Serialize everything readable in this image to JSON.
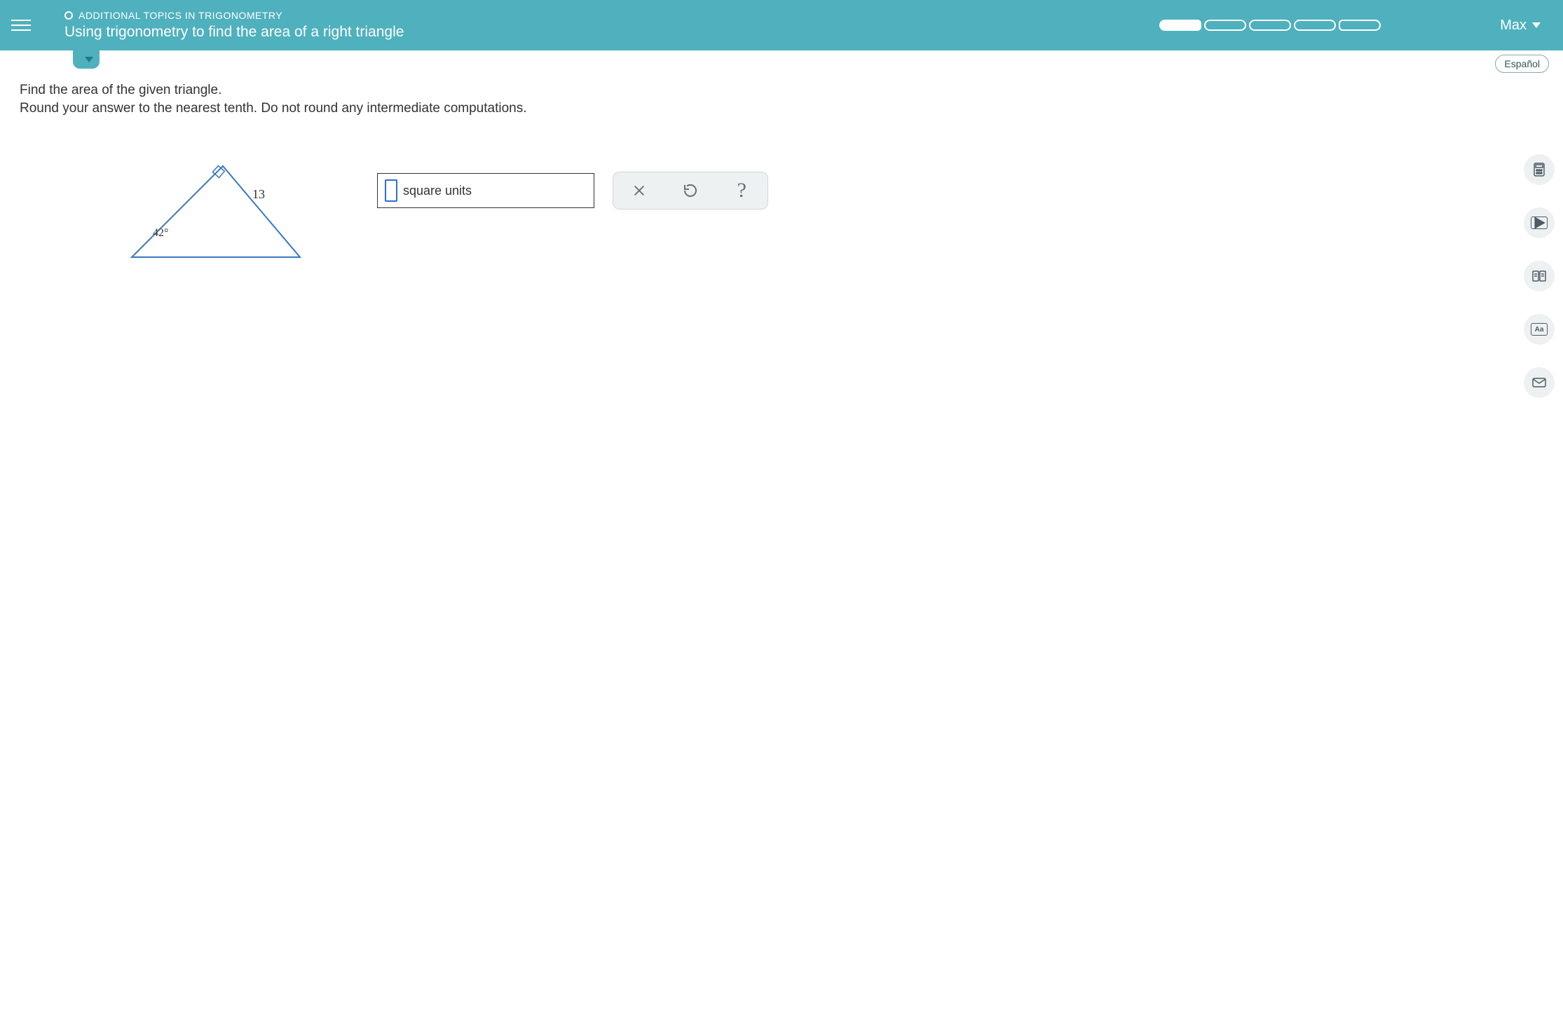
{
  "header": {
    "breadcrumb": "ADDITIONAL TOPICS IN TRIGONOMETRY",
    "title": "Using trigonometry to find the area of a right triangle",
    "user": "Max"
  },
  "language_button": "Español",
  "prompt": {
    "line1": "Find the area of the given triangle.",
    "line2": "Round your answer to the nearest tenth. Do not round any intermediate computations."
  },
  "triangle": {
    "side_label": "13",
    "angle_label": "42°"
  },
  "answer": {
    "unit_label": "square units"
  },
  "actions": {
    "clear": "✕",
    "reset": "↺",
    "help": "?"
  }
}
